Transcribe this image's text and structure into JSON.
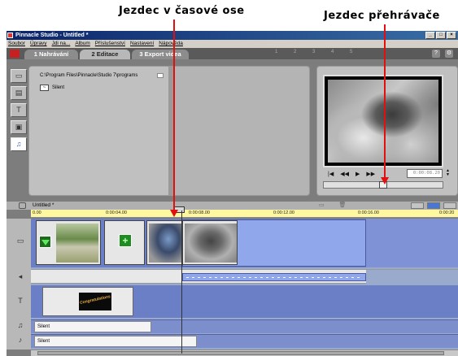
{
  "annotations": {
    "timeline_scrubber": "Jezdec v časové ose",
    "player_scrubber": "Jezdec přehrávače",
    "arrow_color": "#e01010"
  },
  "window": {
    "title": "Pinnacle Studio - Untitled *",
    "buttons": [
      "_",
      "□",
      "×"
    ]
  },
  "menu": [
    "Soubor",
    "Úpravy",
    "Jdi na...",
    "Album",
    "Příslušenství",
    "Nastavení",
    "Nápověda"
  ],
  "tabs": [
    {
      "label": "1 Nahrávání",
      "active": false
    },
    {
      "label": "2 Editace",
      "active": true
    },
    {
      "label": "3 Export videa",
      "active": false
    }
  ],
  "tab_pager": "1 2 3 4 5",
  "album": {
    "path": "C:\\Program Files\\Pinnacle\\Studio 7\\programs",
    "item": "Silent"
  },
  "player": {
    "timecode": "0:00:08.20",
    "controls": [
      "|◀",
      "◀◀",
      "▶",
      "▶▶"
    ]
  },
  "timeline": {
    "project": "Untitled *",
    "ruler_labels": [
      "0.00",
      "0:00:04.00",
      "0:00:08.00",
      "0:00:12.00",
      "0:00:16.00",
      "0:00:20"
    ],
    "title_clip_text": "Congratulations",
    "sound_tracks": [
      "Silent",
      "Silent"
    ],
    "scroll_dots": "· · · ·"
  },
  "colors": {
    "accent": "#4a78d0",
    "timeline_bg": "#6b7fc6",
    "ruler": "#fff8a0"
  }
}
